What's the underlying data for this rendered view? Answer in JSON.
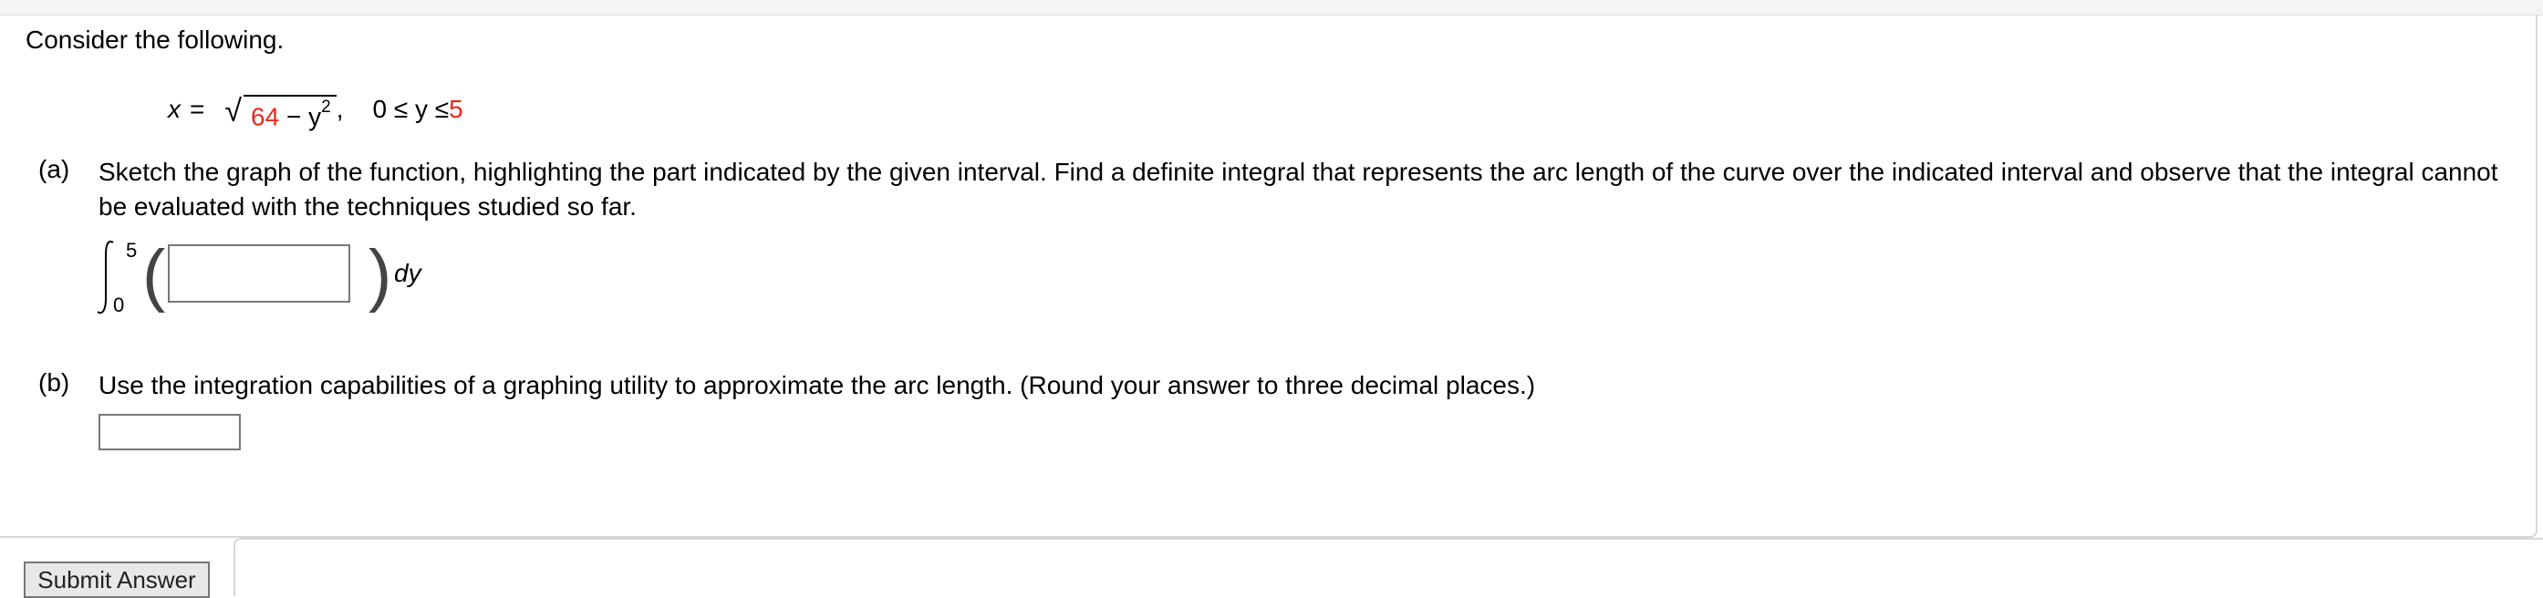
{
  "intro": "Consider the following.",
  "equation": {
    "lhs": "x",
    "equals": "=",
    "radicand_number": "64",
    "radicand_rest": " − y",
    "exponent": "2",
    "comma": ",",
    "interval_prefix": "0 ≤ y ≤ ",
    "interval_upper": "5"
  },
  "part_a": {
    "label": "(a)",
    "text": "Sketch the graph of the function, highlighting the part indicated by the given interval. Find a definite integral that represents the arc length of the curve over the indicated interval and observe that the integral cannot be evaluated with the techniques studied so far.",
    "upper_limit": "5",
    "lower_limit": "0",
    "differential": "dy",
    "answer_value": ""
  },
  "part_b": {
    "label": "(b)",
    "text": "Use the integration capabilities of a graphing utility to approximate the arc length. (Round your answer to three decimal places.)",
    "answer_value": ""
  },
  "submit_label": "Submit Answer",
  "colors": {
    "highlight": "#e8261b"
  }
}
